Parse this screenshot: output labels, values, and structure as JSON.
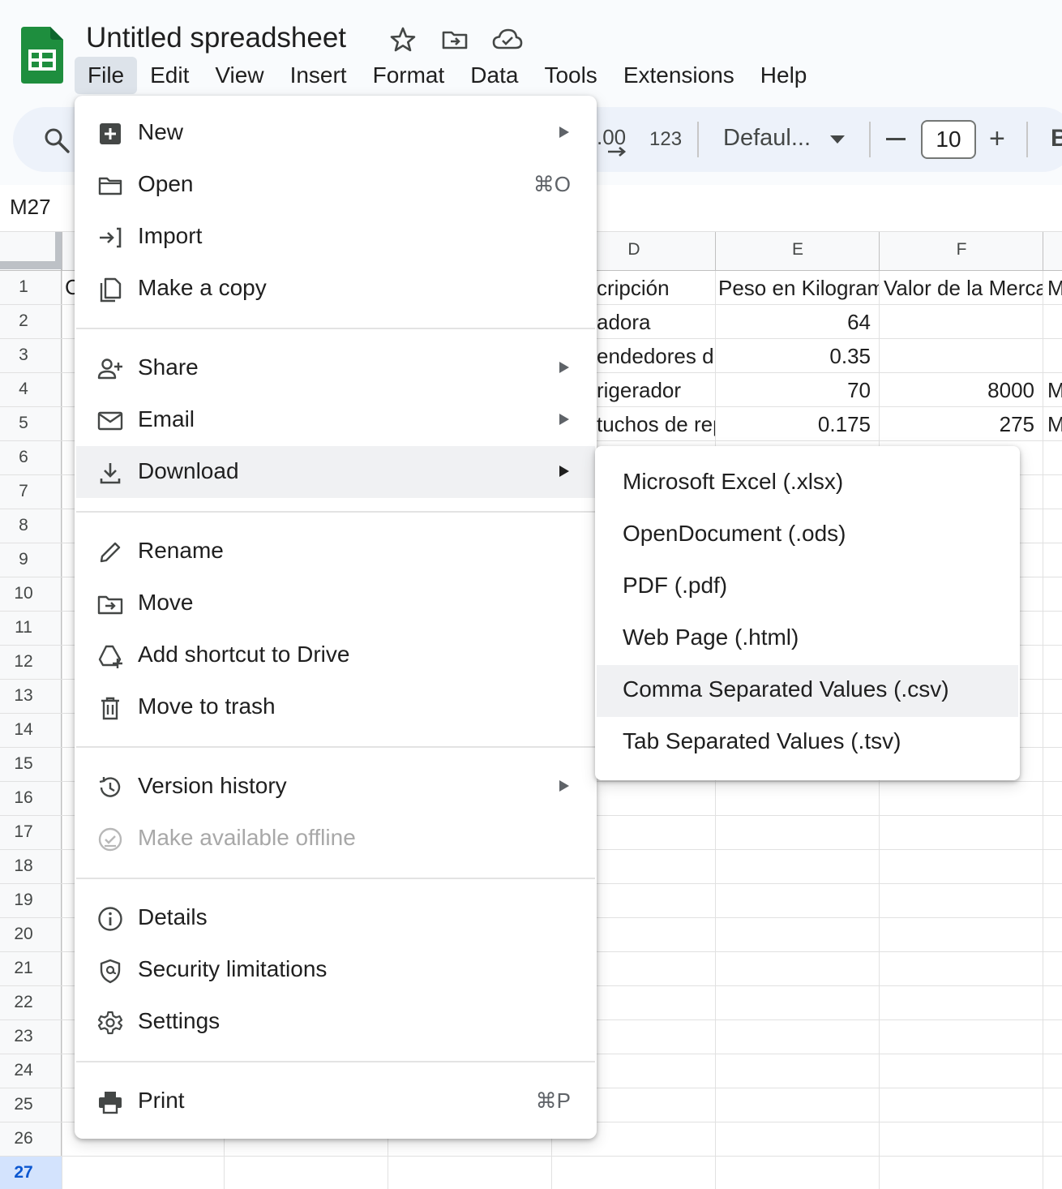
{
  "app": {
    "title": "Untitled spreadsheet",
    "icons": [
      "sheets-logo",
      "star-icon",
      "move-to-folder-icon",
      "cloud-saved-icon"
    ]
  },
  "menubar": {
    "items": [
      {
        "label": "File",
        "active": true
      },
      {
        "label": "Edit"
      },
      {
        "label": "View"
      },
      {
        "label": "Insert"
      },
      {
        "label": "Format"
      },
      {
        "label": "Data"
      },
      {
        "label": "Tools"
      },
      {
        "label": "Extensions"
      },
      {
        "label": "Help"
      }
    ]
  },
  "toolbar": {
    "decimal_label": ".00",
    "number_format_label": "123",
    "font_label": "Defaul...",
    "font_size": "10",
    "plus_label": "+",
    "bold_label": "B"
  },
  "formula_bar": {
    "name_box": "M27"
  },
  "sheet": {
    "column_headers": [
      "D",
      "E",
      "F"
    ],
    "row_numbers": [
      "1",
      "2",
      "3",
      "4",
      "5",
      "6",
      "7",
      "8",
      "9",
      "10",
      "11",
      "12",
      "13",
      "14",
      "15",
      "16",
      "17",
      "18",
      "19",
      "20",
      "21",
      "22",
      "23",
      "24",
      "25",
      "26",
      "27"
    ],
    "selected_row": "27",
    "col_a_fragment": "C",
    "rows": [
      {
        "d": "cripción",
        "e": "Peso en Kilogramos",
        "f": "Valor de la Mercancía",
        "g": "M"
      },
      {
        "d": "adora",
        "e": "64",
        "f": "",
        "g": ""
      },
      {
        "d": "endedores d",
        "e": "0.35",
        "f": "",
        "g": ""
      },
      {
        "d": "rigerador",
        "e": "70",
        "f": "8000",
        "g": "M"
      },
      {
        "d": "tuchos de rep",
        "e": "0.175",
        "f": "275",
        "g": "M"
      }
    ]
  },
  "file_menu": {
    "sections": [
      [
        {
          "label": "New",
          "icon": "new-sheet-icon",
          "submenu": true
        },
        {
          "label": "Open",
          "icon": "folder-open-icon",
          "shortcut": "⌘O"
        },
        {
          "label": "Import",
          "icon": "import-icon"
        },
        {
          "label": "Make a copy",
          "icon": "copy-icon"
        }
      ],
      [
        {
          "label": "Share",
          "icon": "share-person-icon",
          "submenu": true
        },
        {
          "label": "Email",
          "icon": "email-icon",
          "submenu": true
        },
        {
          "label": "Download",
          "icon": "download-icon",
          "submenu": true,
          "highlighted": true
        }
      ],
      [
        {
          "label": "Rename",
          "icon": "pencil-icon"
        },
        {
          "label": "Move",
          "icon": "move-folder-icon"
        },
        {
          "label": "Add shortcut to Drive",
          "icon": "drive-shortcut-icon"
        },
        {
          "label": "Move to trash",
          "icon": "trash-icon"
        }
      ],
      [
        {
          "label": "Version history",
          "icon": "history-icon",
          "submenu": true
        },
        {
          "label": "Make available offline",
          "icon": "offline-check-icon",
          "disabled": true
        }
      ],
      [
        {
          "label": "Details",
          "icon": "info-icon"
        },
        {
          "label": "Security limitations",
          "icon": "security-shield-icon"
        },
        {
          "label": "Settings",
          "icon": "gear-icon"
        }
      ],
      [
        {
          "label": "Print",
          "icon": "printer-icon",
          "shortcut": "⌘P"
        }
      ]
    ]
  },
  "download_submenu": {
    "items": [
      {
        "label": "Microsoft Excel (.xlsx)"
      },
      {
        "label": "OpenDocument (.ods)"
      },
      {
        "label": "PDF (.pdf)"
      },
      {
        "label": "Web Page (.html)"
      },
      {
        "label": "Comma Separated Values (.csv)",
        "highlighted": true
      },
      {
        "label": "Tab Separated Values (.tsv)"
      }
    ]
  },
  "colors": {
    "brand_green": "#188038",
    "menu_highlight": "#f0f1f3",
    "active_menubar": "#dde3ea",
    "selected_row_bg": "#d3e3fd",
    "selected_row_text": "#0b57d0"
  }
}
